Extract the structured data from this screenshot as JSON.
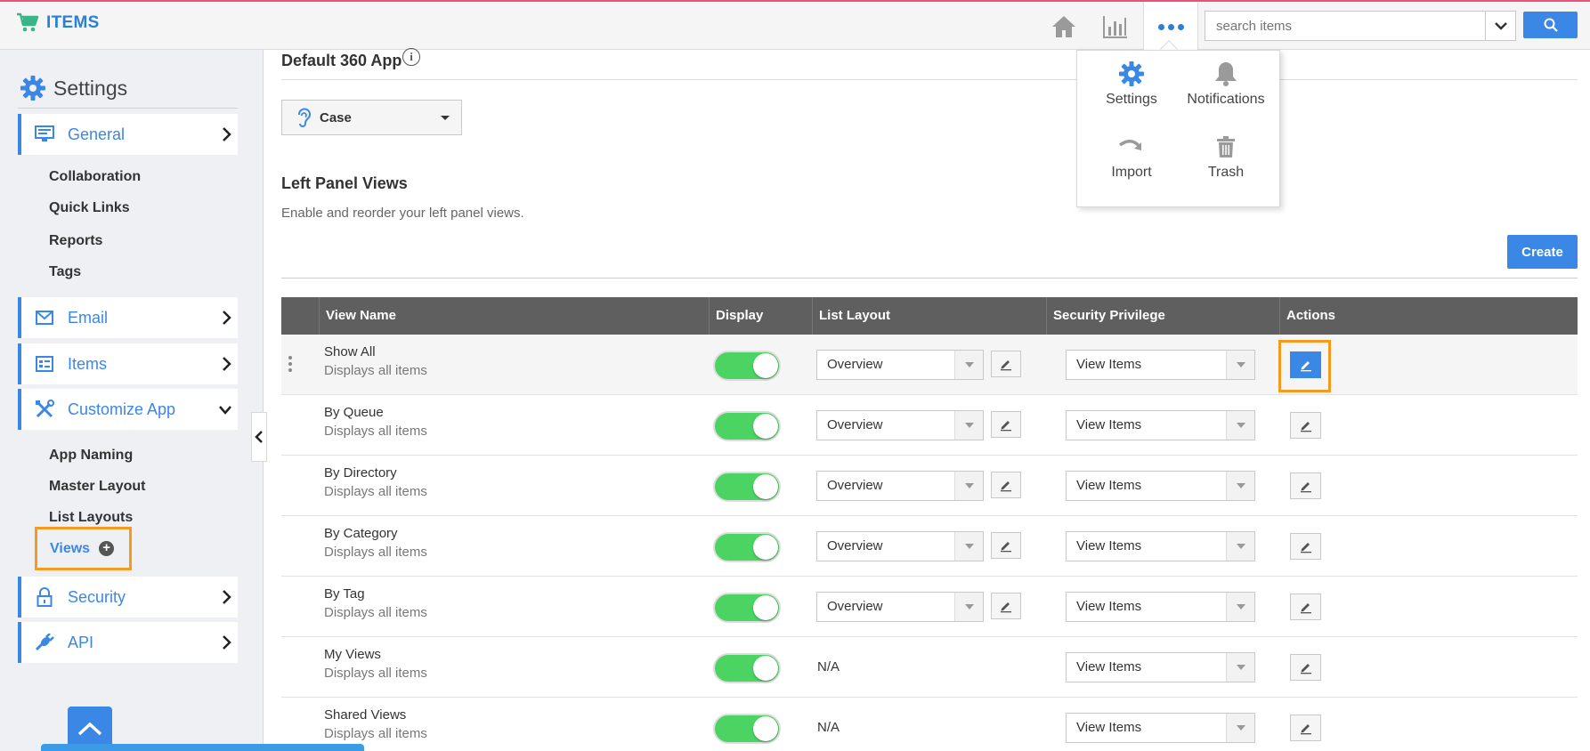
{
  "colors": {
    "accent": "#3b87e6",
    "highlight": "#f39a1f",
    "toggle_on": "#4cd463",
    "topbar_border": "#e8537a"
  },
  "header": {
    "brand": "ITEMS",
    "search": {
      "placeholder": "search items"
    }
  },
  "more_menu": {
    "items": [
      {
        "label": "Settings",
        "icon": "gear-icon"
      },
      {
        "label": "Notifications",
        "icon": "bell-icon"
      },
      {
        "label": "Import",
        "icon": "import-arrow-icon"
      },
      {
        "label": "Trash",
        "icon": "trash-icon"
      }
    ]
  },
  "sidebar": {
    "title": "Settings",
    "sections": [
      {
        "label": "General",
        "icon": "monitor-icon",
        "expanded": false
      },
      {
        "label": "Email",
        "icon": "envelope-icon",
        "expanded": false
      },
      {
        "label": "Items",
        "icon": "list-icon",
        "expanded": false
      },
      {
        "label": "Customize App",
        "icon": "tools-icon",
        "expanded": true
      },
      {
        "label": "Security",
        "icon": "lock-icon",
        "expanded": false
      },
      {
        "label": "API",
        "icon": "plug-icon",
        "expanded": false
      }
    ],
    "general_sub": [
      "Collaboration",
      "Quick Links",
      "Reports",
      "Tags"
    ],
    "customize_sub": [
      "App Naming",
      "Master Layout",
      "List Layouts"
    ],
    "active_sub": "Views"
  },
  "main": {
    "title": "Default 360 App",
    "app_selector": "Case",
    "section_title": "Left Panel Views",
    "section_desc": "Enable and reorder your left panel views.",
    "create_label": "Create",
    "table": {
      "headers": [
        "View Name",
        "Display",
        "List Layout",
        "Security Privilege",
        "Actions"
      ],
      "rows": [
        {
          "name": "Show All",
          "desc": "Displays all items",
          "display": true,
          "layout": "Overview",
          "privilege": "View Items"
        },
        {
          "name": "By Queue",
          "desc": "Displays all items",
          "display": true,
          "layout": "Overview",
          "privilege": "View Items"
        },
        {
          "name": "By Directory",
          "desc": "Displays all items",
          "display": true,
          "layout": "Overview",
          "privilege": "View Items"
        },
        {
          "name": "By Category",
          "desc": "Displays all items",
          "display": true,
          "layout": "Overview",
          "privilege": "View Items"
        },
        {
          "name": "By Tag",
          "desc": "Displays all items",
          "display": true,
          "layout": "Overview",
          "privilege": "View Items"
        },
        {
          "name": "My Views",
          "desc": "Displays all items",
          "display": true,
          "layout": "N/A",
          "privilege": "View Items"
        },
        {
          "name": "Shared Views",
          "desc": "Displays all items",
          "display": true,
          "layout": "N/A",
          "privilege": "View Items"
        }
      ]
    }
  }
}
